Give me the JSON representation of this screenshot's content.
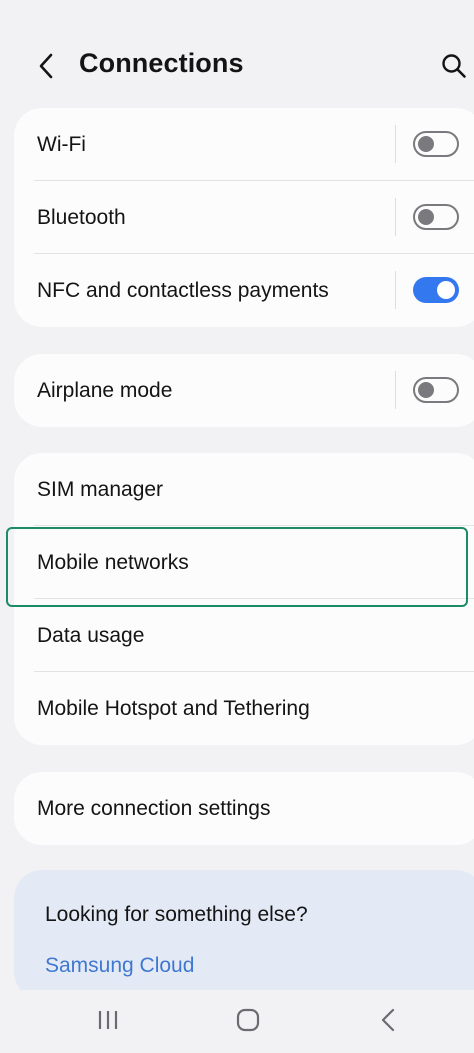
{
  "header": {
    "title": "Connections",
    "back_icon": "chevron-left-icon",
    "search_icon": "search-icon"
  },
  "groups": [
    {
      "items": [
        {
          "label": "Wi-Fi",
          "toggle": "off"
        },
        {
          "label": "Bluetooth",
          "toggle": "off"
        },
        {
          "label": "NFC and contactless payments",
          "toggle": "on"
        }
      ]
    },
    {
      "items": [
        {
          "label": "Airplane mode",
          "toggle": "off"
        }
      ]
    },
    {
      "items": [
        {
          "label": "SIM manager"
        },
        {
          "label": "Mobile networks",
          "highlighted": true
        },
        {
          "label": "Data usage"
        },
        {
          "label": "Mobile Hotspot and Tethering"
        }
      ]
    },
    {
      "items": [
        {
          "label": "More connection settings"
        }
      ]
    }
  ],
  "suggestion": {
    "title": "Looking for something else?",
    "link": "Samsung Cloud"
  },
  "navbar": {
    "recents_icon": "recents-icon",
    "home_icon": "home-icon",
    "back_icon": "back-icon"
  },
  "colors": {
    "accent": "#3478f0",
    "highlight_border": "#1d8a68",
    "link": "#3f78d0",
    "background": "#f2f2f4",
    "card": "#fcfcfd"
  }
}
